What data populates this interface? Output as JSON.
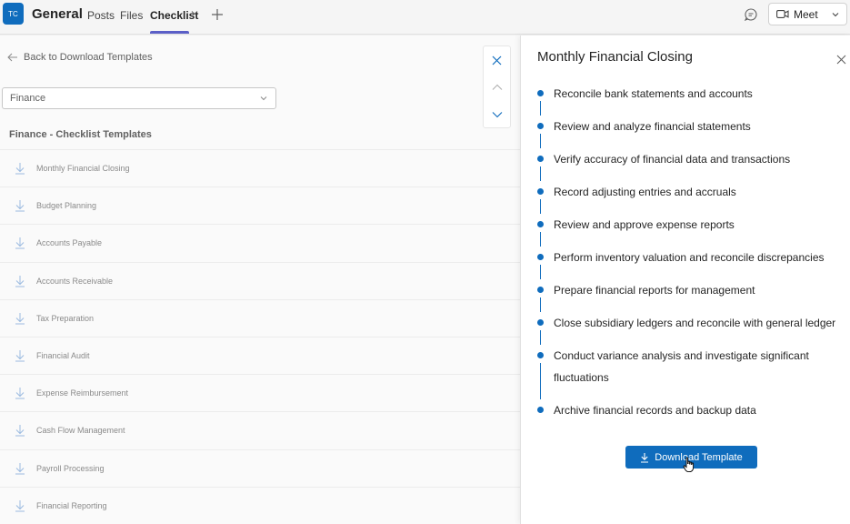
{
  "header": {
    "avatar_initials": "TC",
    "team_name": "General",
    "tabs": [
      {
        "label": "Posts"
      },
      {
        "label": "Files"
      },
      {
        "label": "Checklist"
      }
    ],
    "meet_label": "Meet"
  },
  "left": {
    "back_label": "Back to Download Templates",
    "category_select": {
      "value": "Finance"
    },
    "section_heading": "Finance - Checklist Templates",
    "templates": [
      "Monthly Financial Closing",
      "Budget Planning",
      "Accounts Payable",
      "Accounts Receivable",
      "Tax Preparation",
      "Financial Audit",
      "Expense Reimbursement",
      "Cash Flow Management",
      "Payroll Processing",
      "Financial Reporting"
    ]
  },
  "panel": {
    "title": "Monthly Financial Closing",
    "steps": [
      "Reconcile bank statements and accounts",
      "Review and analyze financial statements",
      "Verify accuracy of financial data and transactions",
      "Record adjusting entries and accruals",
      "Review and approve expense reports",
      "Perform inventory valuation and reconcile discrepancies",
      "Prepare financial reports for management",
      "Close subsidiary ledgers and reconcile with general ledger",
      "Conduct variance analysis and investigate significant fluctuations",
      "Archive financial records and backup data"
    ],
    "download_label": "Download Template"
  },
  "colors": {
    "accent": "#0f6cbd",
    "tab_indicator": "#5b5fc7"
  }
}
